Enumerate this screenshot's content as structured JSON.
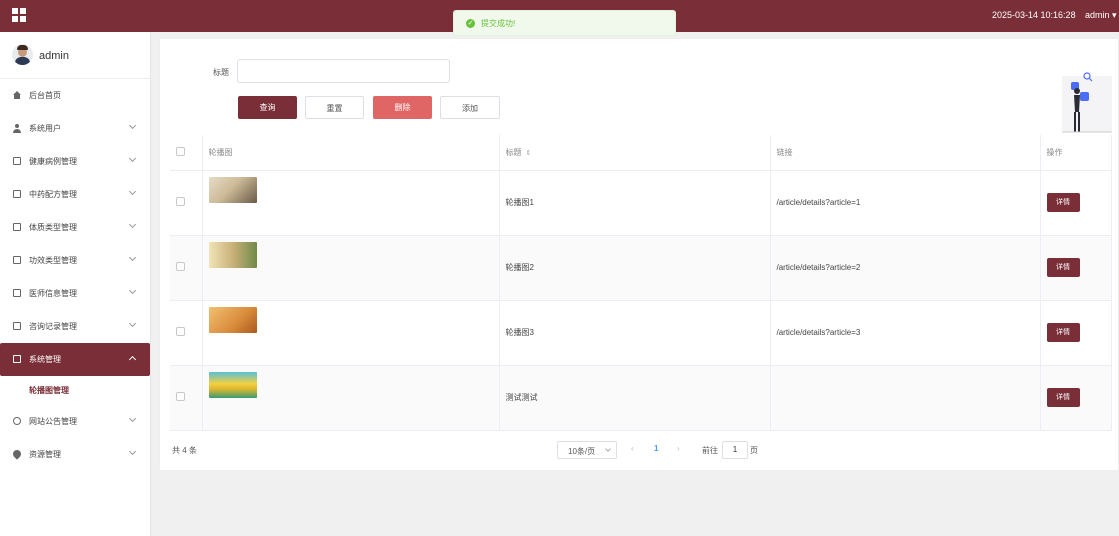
{
  "topbar": {
    "time": "2025-03-14 10:16:28",
    "user": "admin"
  },
  "toast": {
    "message": "提交成功!"
  },
  "profile": {
    "name": "admin"
  },
  "menu": [
    {
      "label": "后台首页",
      "icon": "home-icon"
    },
    {
      "label": "系统用户",
      "icon": "user-icon"
    },
    {
      "label": "健康病例管理",
      "icon": "document-icon"
    },
    {
      "label": "中药配方管理",
      "icon": "document-icon"
    },
    {
      "label": "体质类型管理",
      "icon": "document-icon"
    },
    {
      "label": "功效类型管理",
      "icon": "document-icon"
    },
    {
      "label": "医师信息管理",
      "icon": "document-icon"
    },
    {
      "label": "咨询记录管理",
      "icon": "document-icon"
    },
    {
      "label": "系统管理",
      "icon": "image-icon",
      "active": true
    },
    {
      "label": "轮播图管理",
      "sub": true
    },
    {
      "label": "网站公告管理",
      "icon": "info-icon"
    },
    {
      "label": "资源管理",
      "icon": "location-icon"
    }
  ],
  "search": {
    "label": "标题",
    "value": ""
  },
  "buttons": {
    "query": "查询",
    "reset": "重置",
    "delete": "删除",
    "add": "添加"
  },
  "table": {
    "headers": {
      "image": "轮播图",
      "title": "标题",
      "link": "链接",
      "action": "操作"
    },
    "rows": [
      {
        "title": "轮播图1",
        "link": "/article/details?article=1",
        "action": "详情",
        "thumb_colors": [
          "#d9cbb0",
          "#6b5a48"
        ]
      },
      {
        "title": "轮播图2",
        "link": "/article/details?article=2",
        "action": "详情",
        "thumb_colors": [
          "#e8d9a8",
          "#8c7a4a"
        ]
      },
      {
        "title": "轮播图3",
        "link": "/article/details?article=3",
        "action": "详情",
        "thumb_colors": [
          "#e0a050",
          "#c07030"
        ]
      },
      {
        "title": "测试测试",
        "link": "",
        "action": "详情",
        "thumb_colors": [
          "#f0c840",
          "#4aa890"
        ]
      }
    ]
  },
  "pagination": {
    "total": "共 4 条",
    "pagesize": "10条/页",
    "current": "1",
    "goto_label": "前往",
    "goto_value": "1",
    "page_unit": "页"
  },
  "colors": {
    "primary": "#7a2f38",
    "danger": "#e06666",
    "success": "#67c23a"
  }
}
